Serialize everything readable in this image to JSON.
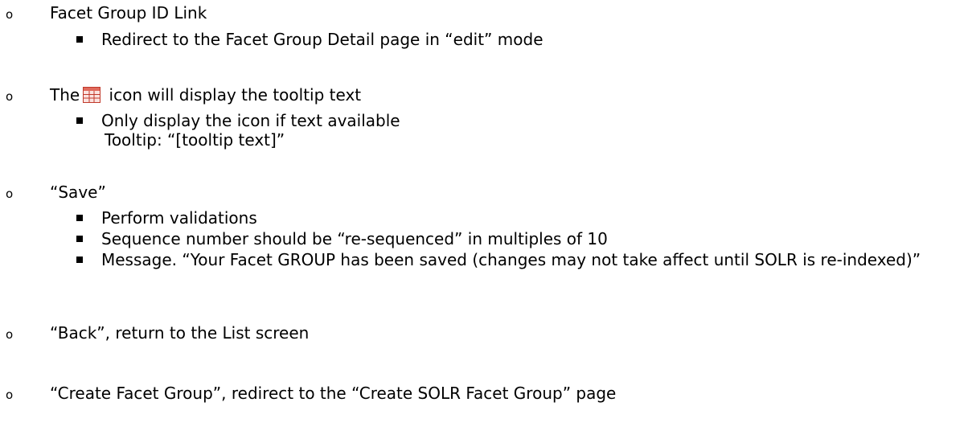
{
  "items": [
    {
      "title": "Facet Group ID Link",
      "subs": [
        "Redirect to the Facet Group Detail page in “edit” mode"
      ]
    },
    {
      "title_before_icon": "The",
      "icon": "table-grid-icon",
      "title_after_icon": "icon will display the tooltip text",
      "subs": [
        "Only display the icon if text available"
      ],
      "continuation": "Tooltip: “[tooltip text]”"
    },
    {
      "title": "“Save”",
      "subs": [
        "Perform validations",
        "Sequence number should be “re-sequenced” in multiples of 10",
        "Message. “Your Facet GROUP has been saved (changes may not take affect until SOLR is re-indexed)”"
      ]
    },
    {
      "title": "“Back”, return to the List screen"
    },
    {
      "title": "“Create Facet Group”, redirect to the “Create SOLR Facet Group” page"
    }
  ],
  "colors": {
    "text": "#000000",
    "icon_border": "#c0392b",
    "icon_fill": "#fbe3e0"
  }
}
